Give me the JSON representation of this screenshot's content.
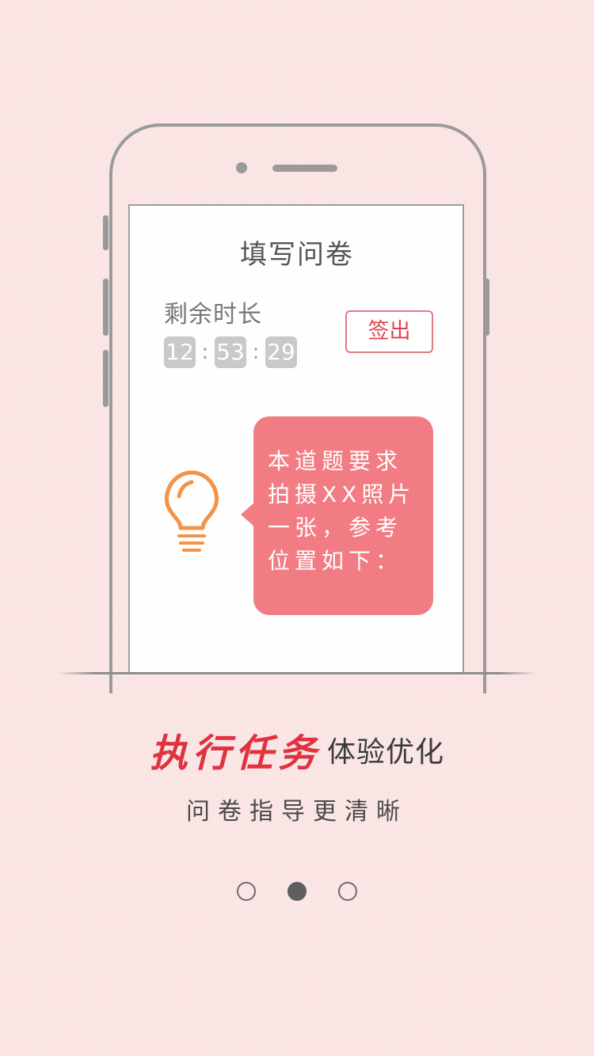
{
  "screen": {
    "title": "填写问卷",
    "remaining_label": "剩余时长",
    "timer": {
      "hours": "12",
      "minutes": "53",
      "seconds": "29",
      "separator": ":"
    },
    "checkout_label": "签出",
    "hint_icon": "lightbulb-icon",
    "hint_text": "本道题要求拍摄XX照片一张，参考位置如下："
  },
  "headline": {
    "emphasis": "执行任务",
    "rest": "体验优化"
  },
  "subtitle": "问卷指导更清晰",
  "pagination": {
    "total": 3,
    "active_index": 1
  },
  "colors": {
    "background": "#fbe5e5",
    "accent_red": "#e0323f",
    "bubble": "#f27c84",
    "bulb": "#f39347",
    "frame": "#9a9a9a"
  }
}
